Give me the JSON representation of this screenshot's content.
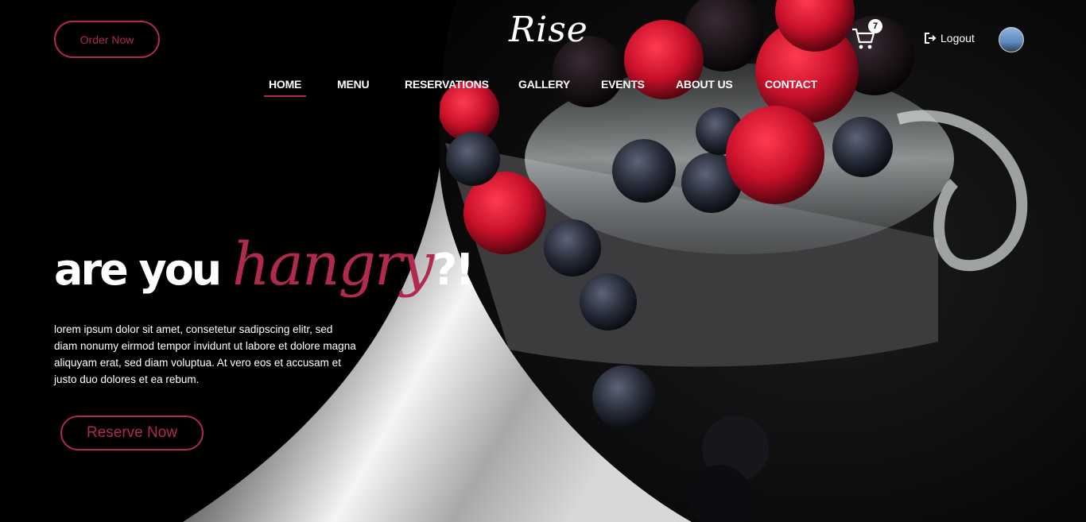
{
  "header": {
    "order_button_label": "Order Now",
    "logo_text": "Rise",
    "cart_count": "7",
    "logout_label": "Logout"
  },
  "nav": {
    "items": [
      {
        "label": "HOME",
        "active": true
      },
      {
        "label": "MENU"
      },
      {
        "label": "RESERVATIONS"
      },
      {
        "label": "GALLERY"
      },
      {
        "label": "EVENTS"
      },
      {
        "label": "ABOUT US"
      },
      {
        "label": "CONTACT"
      }
    ]
  },
  "hero": {
    "headline_part1": "are you ",
    "headline_accent": "hangry",
    "headline_part2": "?!",
    "description": "lorem ipsum dolor sit amet, consetetur sadipscing elitr, sed diam nonumy eirmod tempor invidunt ut labore et dolore magna aliquyam erat, sed diam voluptua. At vero eos et accusam et justo duo dolores et ea rebum.",
    "reserve_button_label": "Reserve Now"
  },
  "icons": {
    "cart": "cart-icon",
    "logout": "logout-icon",
    "avatar": "user-avatar"
  },
  "colors": {
    "accent": "#b02a4d",
    "background": "#000000",
    "text": "#ffffff"
  }
}
